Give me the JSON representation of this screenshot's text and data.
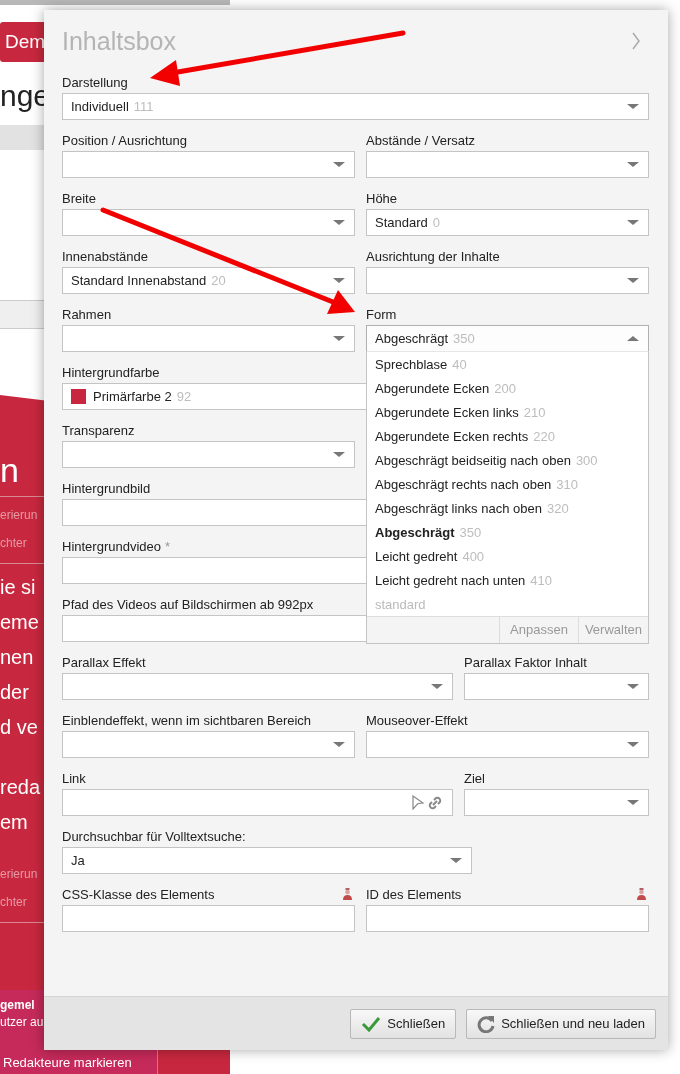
{
  "background_page": {
    "button": "Dem",
    "heading": "nge",
    "hero": {
      "title": "n",
      "meta_top": [
        "erierun",
        "chter"
      ],
      "body": [
        "ie si",
        "eme",
        "nen",
        "der",
        "d ve",
        "reda",
        "em"
      ],
      "meta_bottom": [
        "erierun",
        "chter"
      ]
    },
    "notice": {
      "title": "gemel",
      "text": "utzer au"
    },
    "footer_link": "Redakteure markieren"
  },
  "dialog": {
    "title": "Inhaltsbox",
    "rows": [
      {
        "kind": "full",
        "fields": [
          {
            "label": "Darstellung",
            "kind": "select",
            "value": "Individuell",
            "code": "111"
          }
        ]
      },
      {
        "kind": "pair",
        "fields": [
          {
            "label": "Position / Ausrichtung",
            "kind": "select"
          },
          {
            "label": "Abstände / Versatz",
            "kind": "select"
          }
        ]
      },
      {
        "kind": "pair",
        "fields": [
          {
            "label": "Breite",
            "kind": "select"
          },
          {
            "label": "Höhe",
            "kind": "select",
            "value": "Standard",
            "code": "0"
          }
        ]
      },
      {
        "kind": "pair",
        "fields": [
          {
            "label": "Innenabstände",
            "kind": "select",
            "value": "Standard Innenabstand",
            "code": "20"
          },
          {
            "label": "Ausrichtung der Inhalte",
            "kind": "select"
          }
        ]
      },
      {
        "kind": "pair",
        "fields": [
          {
            "label": "Rahmen",
            "kind": "select"
          },
          {
            "label": "Form",
            "kind": "select",
            "value": "Abgeschrägt",
            "code": "350",
            "expanded": true,
            "options": [
              {
                "label": "Sprechblase",
                "code": "40",
                "selected": false
              },
              {
                "label": "Abgerundete Ecken",
                "code": "200",
                "selected": false
              },
              {
                "label": "Abgerundete Ecken links",
                "code": "210",
                "selected": false
              },
              {
                "label": "Abgerundete Ecken rechts",
                "code": "220",
                "selected": false
              },
              {
                "label": "Abgeschrägt beidseitig nach oben",
                "code": "300",
                "selected": false
              },
              {
                "label": "Abgeschrägt rechts nach oben",
                "code": "310",
                "selected": false
              },
              {
                "label": "Abgeschrägt links nach oben",
                "code": "320",
                "selected": false
              },
              {
                "label": "Abgeschrägt",
                "code": "350",
                "selected": true
              },
              {
                "label": "Leicht gedreht",
                "code": "400",
                "selected": false
              },
              {
                "label": "Leicht gedreht nach unten",
                "code": "410",
                "selected": false
              },
              {
                "label": "standard",
                "kind": "empty",
                "selected": false
              }
            ],
            "option_actions": [
              "Anpassen",
              "Verwalten"
            ]
          }
        ]
      },
      {
        "kind": "full",
        "fields": [
          {
            "label": "Hintergrundfarbe",
            "kind": "color",
            "value": "Primärfarbe 2",
            "code": "92",
            "color": "#c8283f"
          }
        ]
      },
      {
        "kind": "half",
        "fields": [
          {
            "label": "Transparenz",
            "kind": "select"
          }
        ]
      },
      {
        "kind": "full",
        "fields": [
          {
            "label": "Hintergrundbild",
            "kind": "text"
          }
        ]
      },
      {
        "kind": "full",
        "fields": [
          {
            "label": "Hintergrundvideo",
            "kind": "text",
            "marker": "*"
          }
        ]
      },
      {
        "kind": "full",
        "fields": [
          {
            "label": "Pfad des Videos auf Bildschirmen ab 992px",
            "kind": "text"
          }
        ]
      },
      {
        "kind": "wide-narrow",
        "fields": [
          {
            "label": "Parallax Effekt",
            "kind": "select"
          },
          {
            "label": "Parallax Faktor Inhalt",
            "kind": "select"
          }
        ]
      },
      {
        "kind": "pair",
        "fields": [
          {
            "label": "Einblendeffekt, wenn im sichtbaren Bereich",
            "kind": "select"
          },
          {
            "label": "Mouseover-Effekt",
            "kind": "select"
          }
        ]
      },
      {
        "kind": "wide-narrow",
        "fields": [
          {
            "label": "Link",
            "kind": "link"
          },
          {
            "label": "Ziel",
            "kind": "select"
          }
        ]
      },
      {
        "kind": "medium",
        "fields": [
          {
            "label": "Durchsuchbar für Volltextsuche:",
            "kind": "select",
            "value": "Ja"
          }
        ]
      },
      {
        "kind": "pair",
        "fields": [
          {
            "label": "CSS-Klasse des Elements",
            "kind": "text",
            "locked": true
          },
          {
            "label": "ID des Elements",
            "kind": "text",
            "locked": true
          }
        ]
      }
    ],
    "buttons": [
      {
        "label": "Schließen",
        "kind": "confirm"
      },
      {
        "label": "Schließen und neu laden",
        "kind": "reload"
      }
    ]
  }
}
